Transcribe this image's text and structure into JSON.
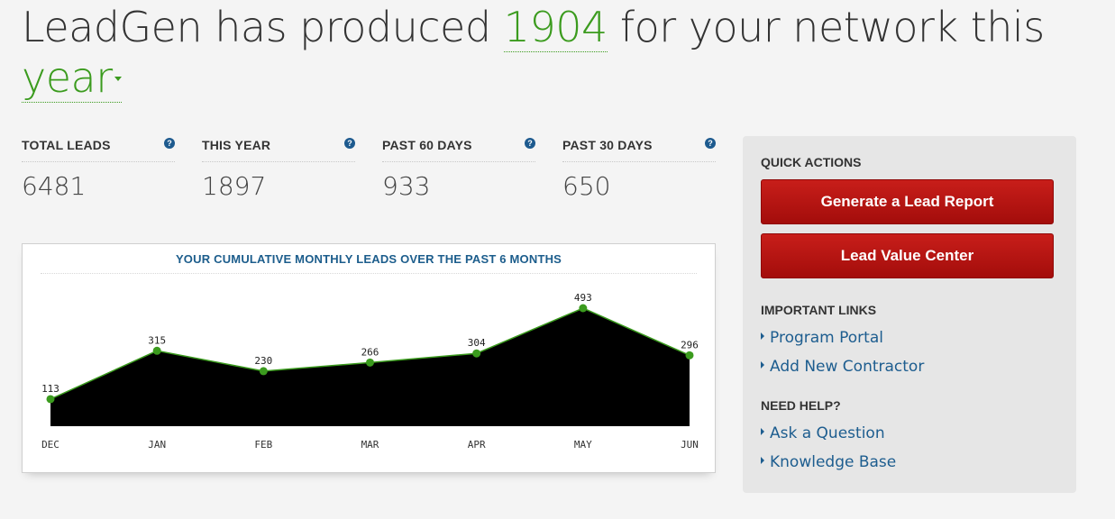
{
  "headline": {
    "prefix": "LeadGen has produced ",
    "count": "1904",
    "middle": " for your network this ",
    "period": "year"
  },
  "stats": [
    {
      "label": "TOTAL LEADS",
      "value": "6481"
    },
    {
      "label": "THIS YEAR",
      "value": "1897"
    },
    {
      "label": "PAST 60 DAYS",
      "value": "933"
    },
    {
      "label": "PAST 30 DAYS",
      "value": "650"
    }
  ],
  "help_glyph": "?",
  "chart_data": {
    "type": "area",
    "title": "YOUR CUMULATIVE MONTHLY LEADS OVER THE PAST 6 MONTHS",
    "categories": [
      "DEC",
      "JAN",
      "FEB",
      "MAR",
      "APR",
      "MAY",
      "JUN"
    ],
    "values": [
      113,
      315,
      230,
      266,
      304,
      493,
      296
    ],
    "fill_color": "#000000",
    "line_color": "#3b9b1e",
    "point_color": "#3b9b1e"
  },
  "panel": {
    "quick_actions_title": "QUICK ACTIONS",
    "btn_report": "Generate a Lead Report",
    "btn_value": "Lead Value Center",
    "important_links_title": "IMPORTANT LINKS",
    "links_important": [
      "Program Portal",
      "Add New Contractor"
    ],
    "need_help_title": "NEED HELP?",
    "links_help": [
      "Ask a Question",
      "Knowledge Base"
    ]
  },
  "colors": {
    "accent_green": "#3b9b1e",
    "link_blue": "#1d5d8f",
    "button_red": "#b3110f"
  }
}
